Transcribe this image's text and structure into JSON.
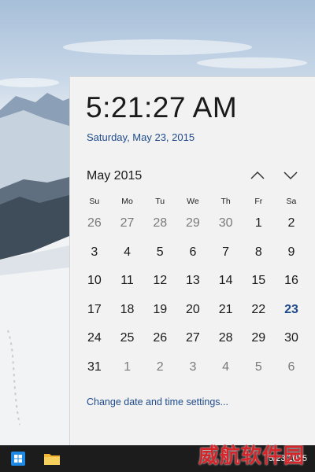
{
  "clock": {
    "time": "5:21:27 AM",
    "date_long": "Saturday, May 23, 2015"
  },
  "calendar": {
    "month_label": "May 2015",
    "days_of_week": [
      "Su",
      "Mo",
      "Tu",
      "We",
      "Th",
      "Fr",
      "Sa"
    ],
    "weeks": [
      [
        {
          "d": "26",
          "dim": true
        },
        {
          "d": "27",
          "dim": true
        },
        {
          "d": "28",
          "dim": true
        },
        {
          "d": "29",
          "dim": true
        },
        {
          "d": "30",
          "dim": true
        },
        {
          "d": "1"
        },
        {
          "d": "2"
        }
      ],
      [
        {
          "d": "3"
        },
        {
          "d": "4"
        },
        {
          "d": "5"
        },
        {
          "d": "6"
        },
        {
          "d": "7"
        },
        {
          "d": "8"
        },
        {
          "d": "9"
        }
      ],
      [
        {
          "d": "10"
        },
        {
          "d": "11"
        },
        {
          "d": "12"
        },
        {
          "d": "13"
        },
        {
          "d": "14"
        },
        {
          "d": "15"
        },
        {
          "d": "16"
        }
      ],
      [
        {
          "d": "17"
        },
        {
          "d": "18"
        },
        {
          "d": "19"
        },
        {
          "d": "20"
        },
        {
          "d": "21"
        },
        {
          "d": "22"
        },
        {
          "d": "23",
          "today": true
        }
      ],
      [
        {
          "d": "24"
        },
        {
          "d": "25"
        },
        {
          "d": "26"
        },
        {
          "d": "27"
        },
        {
          "d": "28"
        },
        {
          "d": "29"
        },
        {
          "d": "30"
        }
      ],
      [
        {
          "d": "31"
        },
        {
          "d": "1",
          "dim": true
        },
        {
          "d": "2",
          "dim": true
        },
        {
          "d": "3",
          "dim": true
        },
        {
          "d": "4",
          "dim": true
        },
        {
          "d": "5",
          "dim": true
        },
        {
          "d": "6",
          "dim": true
        }
      ]
    ],
    "settings_link": "Change date and time settings..."
  },
  "taskbar": {
    "icons": [
      "start-icon",
      "file-explorer-icon"
    ],
    "tray_date": "5/23/2015",
    "watermark": "威航软件园"
  },
  "colors": {
    "accent": "#1f4b8a",
    "flyout_bg": "#f2f2f2",
    "taskbar_bg": "#1c1c1c"
  }
}
